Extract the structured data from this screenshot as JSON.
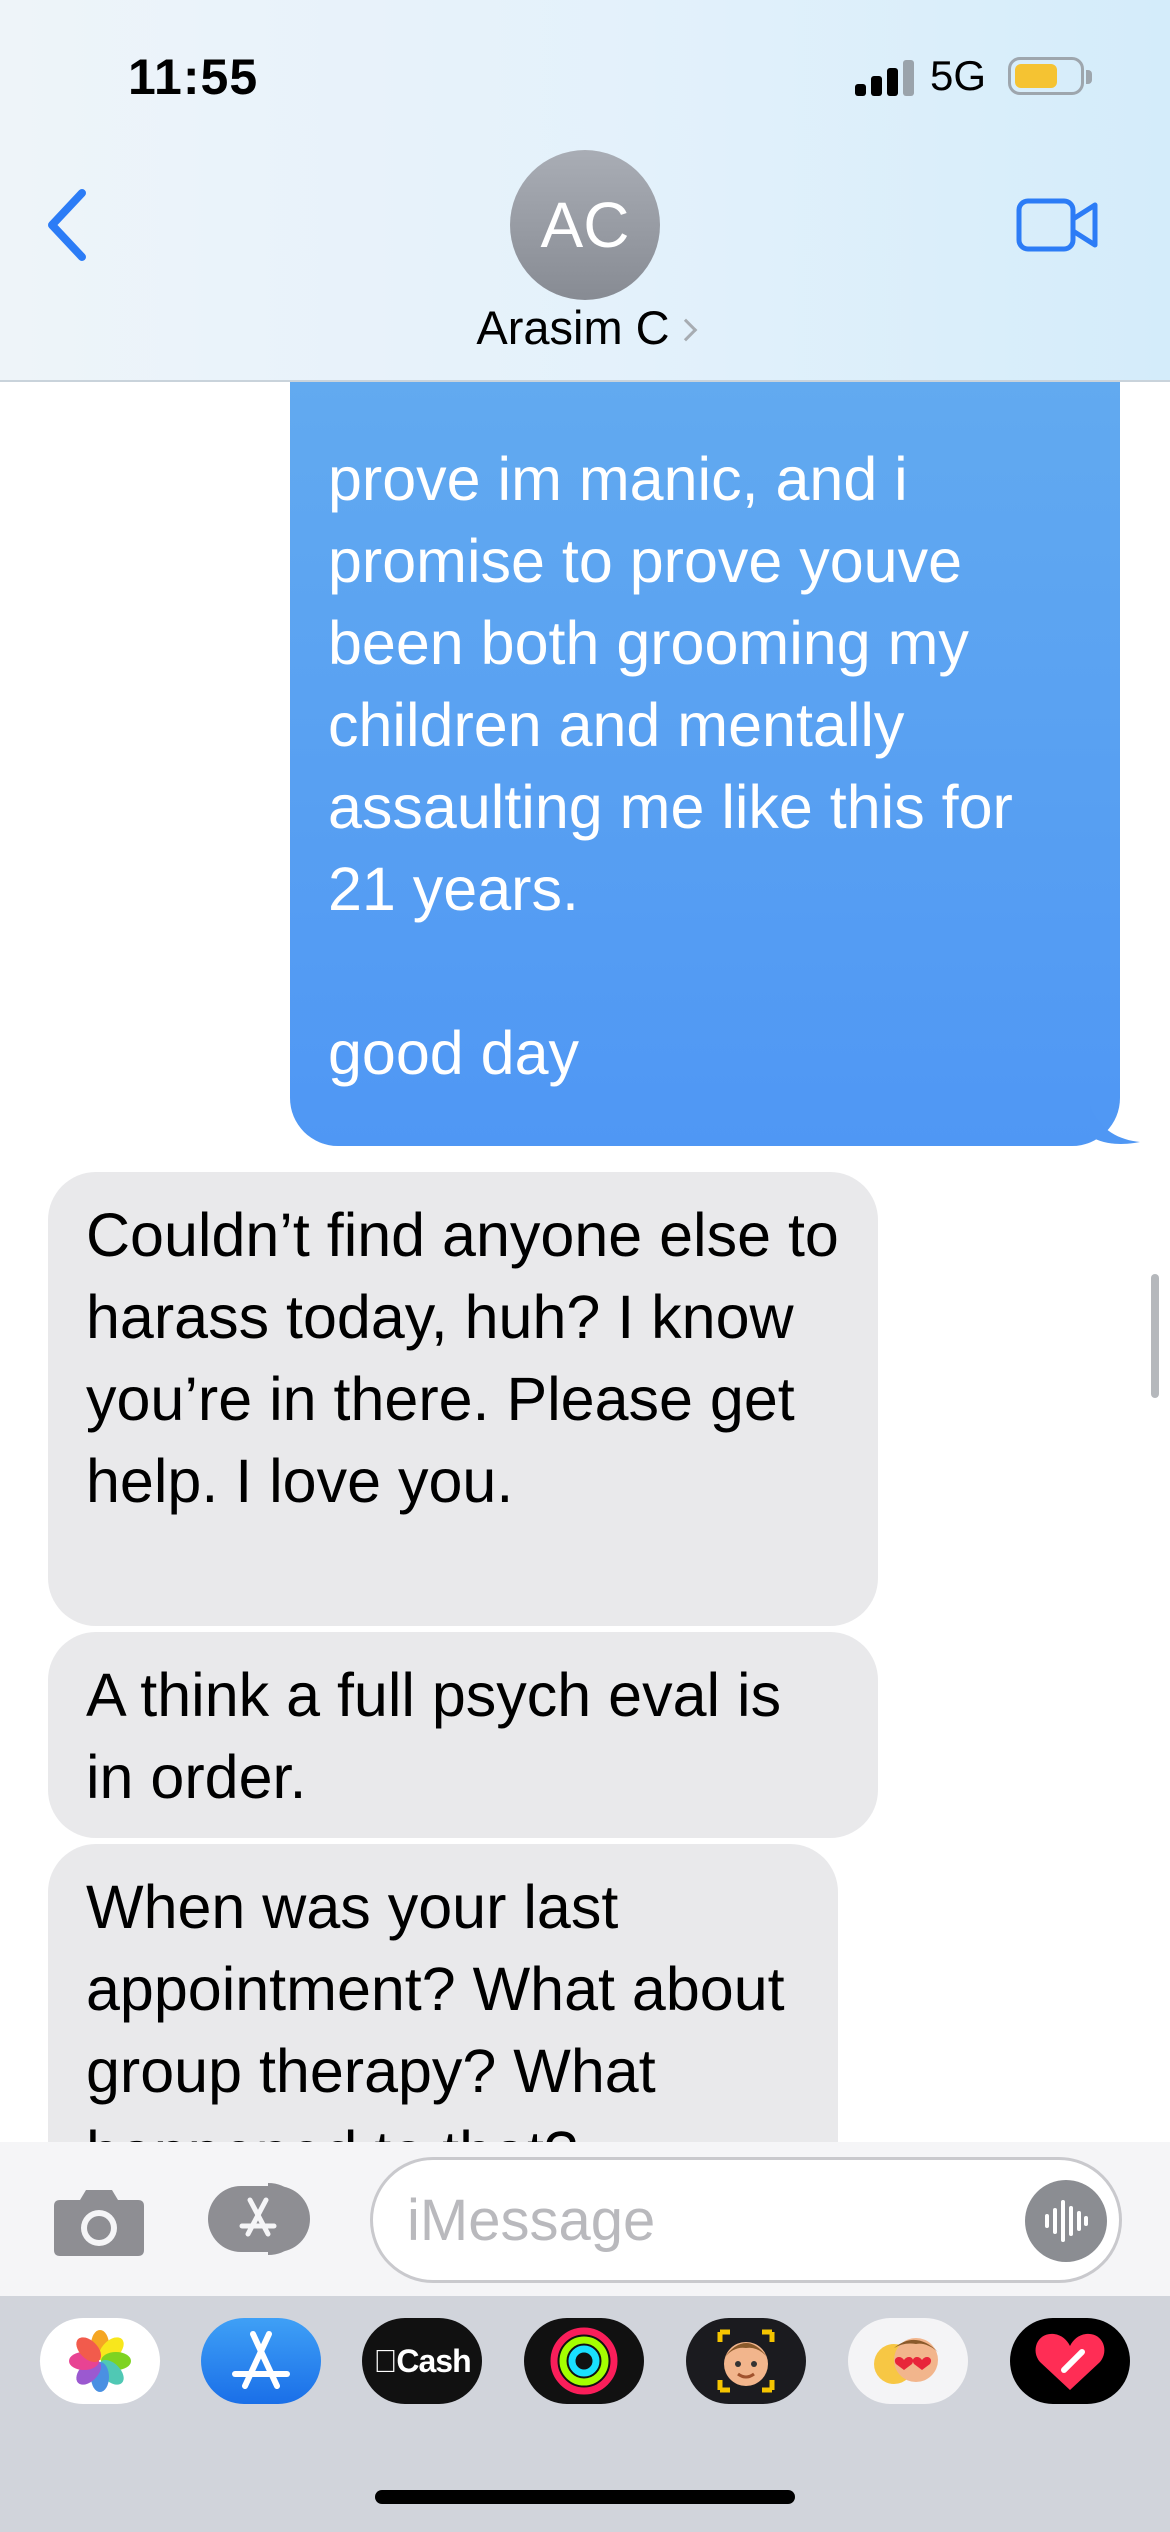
{
  "status_bar": {
    "time": "11:55",
    "network": "5G",
    "battery_level": 0.65
  },
  "header": {
    "avatar_initials": "AC",
    "contact_name": "Arasim C"
  },
  "messages": [
    {
      "direction": "sent",
      "text": "prove im manic, and i\npromise to prove youve\nbeen both grooming my\nchildren and mentally\nassaulting me like this for\n21 years.\n\ngood day"
    },
    {
      "direction": "received",
      "text": "Couldn’t find anyone else to harass today, huh?  I know you’re in there.  Please get help.  I love you."
    },
    {
      "direction": "received",
      "text": "A think a full psych eval is in order."
    },
    {
      "direction": "received",
      "text": "When was your last appointment?  What about group therapy?  What happened to that?"
    }
  ],
  "input": {
    "placeholder": "iMessage",
    "value": ""
  },
  "app_drawer": {
    "apps": [
      {
        "name": "photos-app-icon"
      },
      {
        "name": "app-store-app-icon"
      },
      {
        "name": "cash-app-icon",
        "label": "Cash"
      },
      {
        "name": "activity-app-icon"
      },
      {
        "name": "memoji-app-icon"
      },
      {
        "name": "animoji-stickers-app-icon"
      },
      {
        "name": "digital-touch-app-icon"
      }
    ]
  },
  "colors": {
    "sent_bubble": "#4f97f4",
    "received_bubble": "#e9e9eb",
    "accent": "#2c7cf6"
  }
}
